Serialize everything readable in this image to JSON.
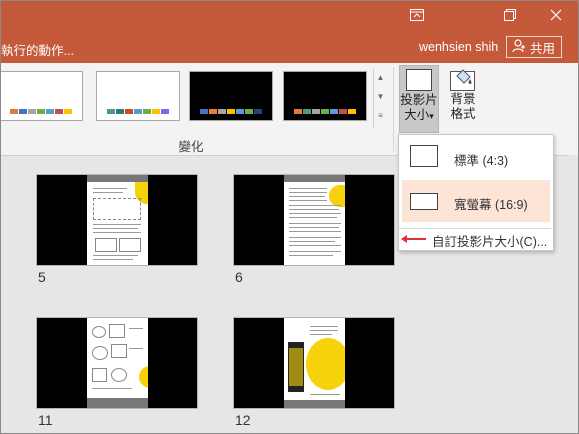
{
  "titlebar": {
    "command_text": "執行的動作...",
    "user_name": "wenhsien shih",
    "share_label": "共用",
    "buttons": [
      "ribbon-display-icon",
      "restore-icon",
      "close-icon"
    ]
  },
  "ribbon": {
    "group_label": "變化",
    "variants": [
      {
        "background": "#ffffff",
        "bar_colors": [
          "#e07b39",
          "#4472c4",
          "#a5a5a5",
          "#70ad47",
          "#5b9bd5",
          "#c0504d",
          "#ffc000"
        ]
      },
      {
        "background": "#ffffff",
        "bar_colors": [
          "#4a9a8a",
          "#2e7d6f",
          "#d24726",
          "#5b9bd5",
          "#70ad47",
          "#ffc000",
          "#7b68ee"
        ]
      },
      {
        "background": "#000000",
        "bar_colors": [
          "#4472c4",
          "#ed7d31",
          "#a5a5a5",
          "#ffc000",
          "#5b9bd5",
          "#70ad47",
          "#264478"
        ]
      },
      {
        "background": "#000000",
        "bar_colors": [
          "#e07b39",
          "#4a9a8a",
          "#a5a5a5",
          "#70ad47",
          "#5b9bd5",
          "#c0504d",
          "#ffc000"
        ]
      }
    ],
    "slide_size": {
      "line1": "投影片",
      "line2": "大小",
      "caret": "▾"
    },
    "background_format": {
      "line1": "背景",
      "line2": "格式"
    }
  },
  "menu": {
    "items": [
      {
        "label": "標準 (4:3)",
        "selected": false
      },
      {
        "label": "寬螢幕 (16:9)",
        "selected": true
      }
    ],
    "custom_label": "自訂投影片大小(C)..."
  },
  "slides": [
    {
      "number": "5"
    },
    {
      "number": "6"
    },
    {
      "number": "11"
    },
    {
      "number": "12"
    }
  ],
  "colors": {
    "titlebar": "#c55a3a",
    "selected_item": "#fce4d6",
    "annotation_arrow": "#e03030"
  }
}
